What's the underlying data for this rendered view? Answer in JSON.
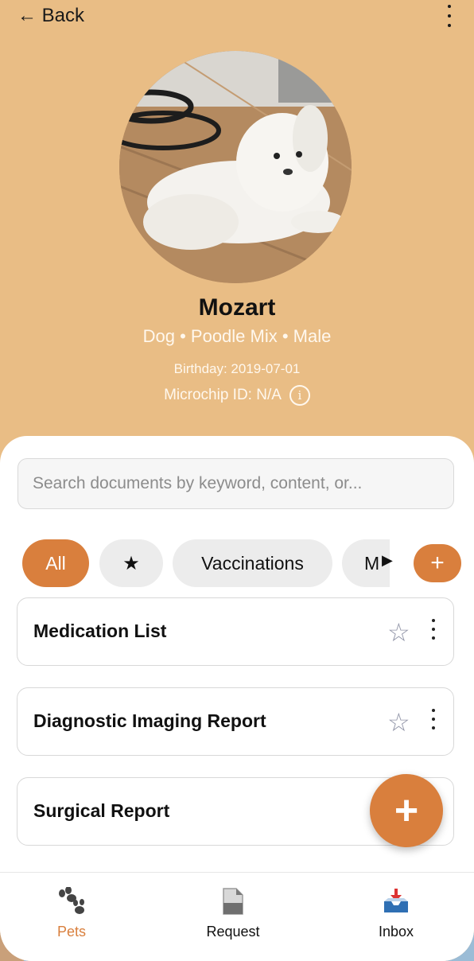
{
  "header": {
    "back_label": "← Back",
    "menu_icon": "more-vertical-icon"
  },
  "pet": {
    "name": "Mozart",
    "details": "Dog • Poodle Mix • Male",
    "birthday": "Birthday: 2019-07-01",
    "microchip": "Microchip ID: N/A",
    "info_icon_glyph": "i"
  },
  "search": {
    "placeholder": "Search documents by keyword, content, or..."
  },
  "filters": {
    "all": "All",
    "starred_glyph": "★",
    "vaccinations": "Vaccinations",
    "more_truncated": "M",
    "scroll_glyph": "▶",
    "add_glyph": "+"
  },
  "documents": [
    {
      "title": "Medication List",
      "star": "☆"
    },
    {
      "title": "Diagnostic Imaging Report",
      "star": "☆"
    },
    {
      "title": "Surgical Report",
      "star": ""
    }
  ],
  "fab": {
    "glyph": "+"
  },
  "tabs": {
    "pets": "Pets",
    "request": "Request",
    "inbox": "Inbox"
  },
  "colors": {
    "header_bg": "#e9bd85",
    "accent": "#d97f3d",
    "chip_bg": "#ececec",
    "star_outline": "#8f93a6"
  }
}
